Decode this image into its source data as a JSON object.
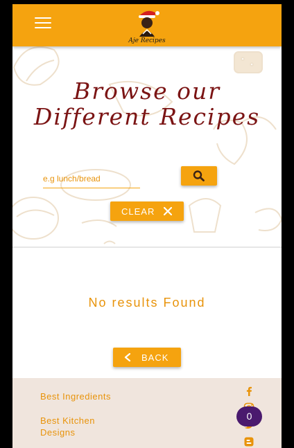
{
  "header": {
    "menu_icon": "hamburger-menu-icon",
    "logo_text": "Aje Recipes"
  },
  "hero": {
    "title_line1": "Browse our",
    "title_line2": "Different Recipes",
    "search_placeholder": "e.g lunch/bread",
    "search_value": "",
    "search_icon": "search-icon",
    "clear_label": "CLEAR",
    "clear_icon": "close-icon"
  },
  "results": {
    "message": "No results Found"
  },
  "back": {
    "label": "BACK",
    "icon": "chevron-left-icon"
  },
  "footer": {
    "links": [
      "Best Ingredients",
      "Best Kitchen Designs"
    ],
    "social_icons": [
      "facebook-icon",
      "instagram-icon",
      "twitter-icon",
      "blogger-icon"
    ]
  },
  "cart_badge": {
    "count": "0"
  },
  "colors": {
    "accent": "#f5a30f",
    "title": "#7b1414",
    "footer_bg": "#f0e5dd",
    "badge": "#4a1a6e"
  }
}
